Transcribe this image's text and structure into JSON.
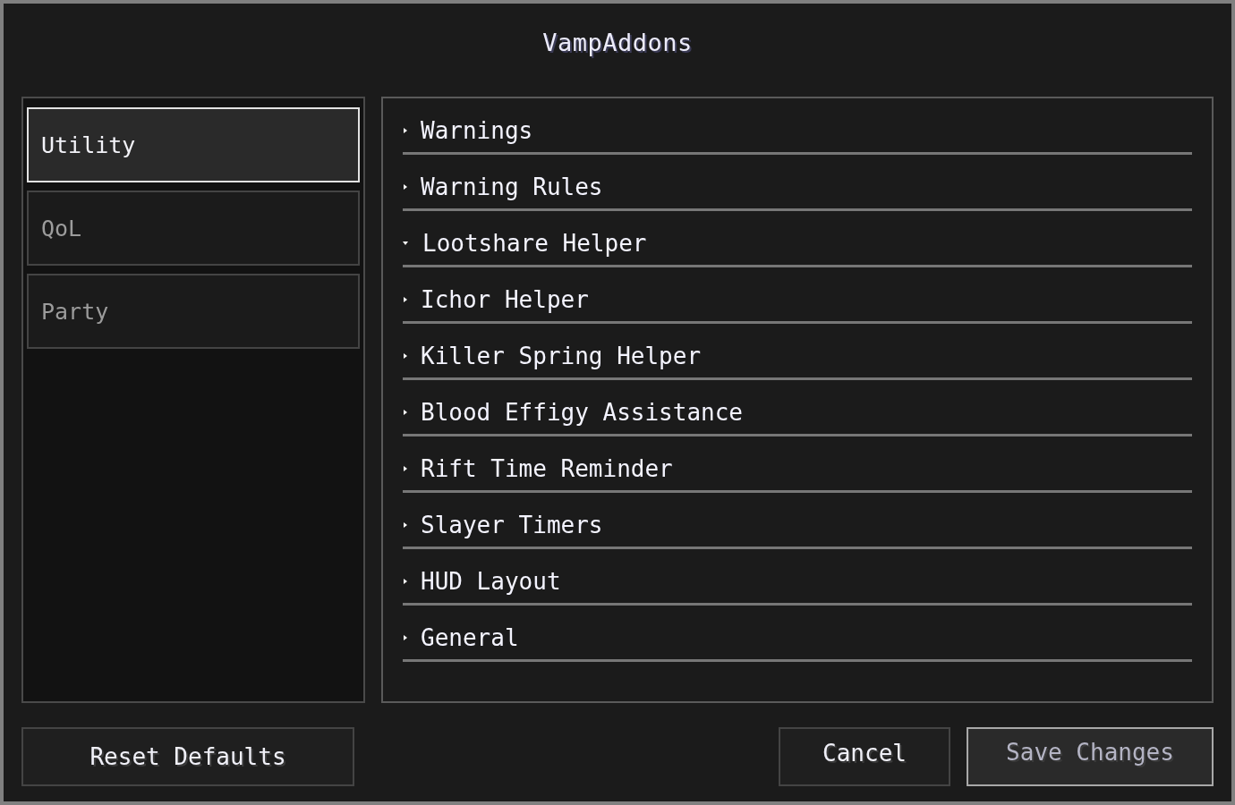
{
  "window": {
    "title": "VampAddons"
  },
  "categories": [
    {
      "label": "Utility",
      "selected": true
    },
    {
      "label": "QoL",
      "selected": false
    },
    {
      "label": "Party",
      "selected": false
    }
  ],
  "sections": [
    {
      "label": "Warnings",
      "expanded": false
    },
    {
      "label": "Warning Rules",
      "expanded": false
    },
    {
      "label": "Lootshare Helper",
      "expanded": true
    },
    {
      "label": "Ichor Helper",
      "expanded": false
    },
    {
      "label": "Killer Spring Helper",
      "expanded": false
    },
    {
      "label": "Blood Effigy Assistance",
      "expanded": false
    },
    {
      "label": "Rift Time Reminder",
      "expanded": false
    },
    {
      "label": "Slayer Timers",
      "expanded": false
    },
    {
      "label": "HUD Layout",
      "expanded": false
    },
    {
      "label": "General",
      "expanded": false
    }
  ],
  "footer": {
    "left_buttons": [
      {
        "label": "Reset Defaults",
        "disabled": false,
        "hovered": false
      }
    ],
    "right_buttons": [
      {
        "label": "Cancel",
        "disabled": false,
        "hovered": false
      },
      {
        "label": "Save Changes",
        "disabled": true,
        "hovered": true
      }
    ]
  }
}
